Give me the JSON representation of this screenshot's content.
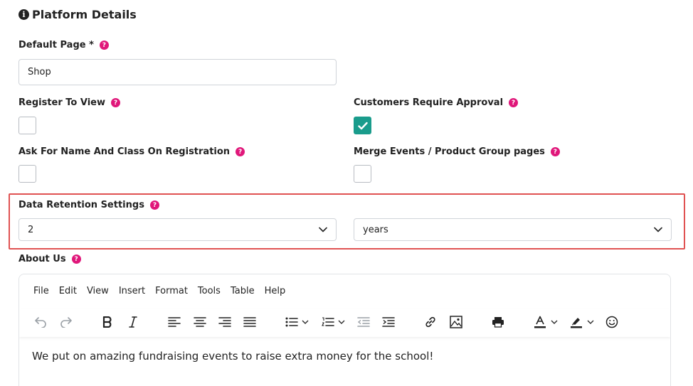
{
  "section": {
    "title": "Platform Details",
    "icon": "info-icon"
  },
  "default_page": {
    "label": "Default Page *",
    "value": "Shop"
  },
  "register_to_view": {
    "label": "Register To View",
    "checked": false
  },
  "customers_require_approval": {
    "label": "Customers Require Approval",
    "checked": true
  },
  "ask_name_class": {
    "label": "Ask For Name And Class On Registration",
    "checked": false
  },
  "merge_events": {
    "label": "Merge Events / Product Group pages",
    "checked": false
  },
  "data_retention": {
    "label": "Data Retention Settings",
    "amount": "2",
    "unit": "years"
  },
  "about_us": {
    "label": "About Us",
    "menu": [
      "File",
      "Edit",
      "View",
      "Insert",
      "Format",
      "Tools",
      "Table",
      "Help"
    ],
    "content": "We put on amazing fundraising events to raise extra money for the school!"
  },
  "help_glyph": "?",
  "colors": {
    "accent": "#1a9c8c",
    "help": "#e0177a",
    "highlight": "#e05252"
  }
}
